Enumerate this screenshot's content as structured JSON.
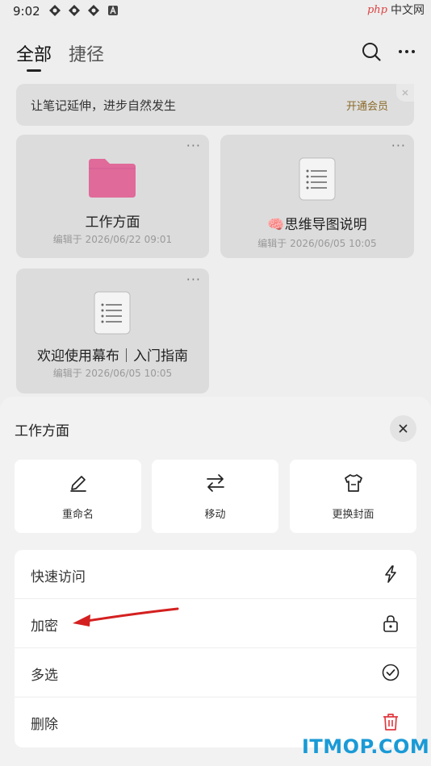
{
  "status": {
    "time": "9:02",
    "status_icons": [
      "app-icon-1",
      "app-icon-2",
      "app-icon-3",
      "text-app-icon"
    ]
  },
  "watermark": {
    "php": "php",
    "cn": "中文网",
    "itmop": "ITMOP.COM"
  },
  "header": {
    "tabs": [
      {
        "label": "全部",
        "active": true
      },
      {
        "label": "捷径",
        "active": false
      }
    ],
    "icons": [
      "search-icon",
      "more-icon"
    ]
  },
  "banner": {
    "text": "让笔记延伸，进步自然发生",
    "action": "开通会员"
  },
  "cards": [
    {
      "type": "folder",
      "title": "工作方面",
      "time": "编辑于 2026/06/22 09:01",
      "more": "···"
    },
    {
      "type": "doc",
      "title": "🧠思维导图说明",
      "time": "编辑于 2026/06/05 10:05",
      "more": "···"
    },
    {
      "type": "doc",
      "title": "欢迎使用幕布｜入门指南",
      "time": "编辑于 2026/06/05 10:05",
      "more": "···"
    }
  ],
  "sheet": {
    "title": "工作方面",
    "actions": [
      {
        "label": "重命名",
        "icon": "pencil-icon"
      },
      {
        "label": "移动",
        "icon": "swap-arrows-icon"
      },
      {
        "label": "更换封面",
        "icon": "shirt-icon"
      }
    ],
    "items": [
      {
        "label": "快速访问",
        "icon": "bolt-icon"
      },
      {
        "label": "加密",
        "icon": "lock-icon"
      },
      {
        "label": "多选",
        "icon": "check-circle-icon"
      },
      {
        "label": "删除",
        "icon": "trash-icon"
      }
    ]
  },
  "colors": {
    "folder": "#e06a9a",
    "danger": "#e0393e",
    "arrow": "#d42020",
    "member": "#8a6a2a"
  }
}
